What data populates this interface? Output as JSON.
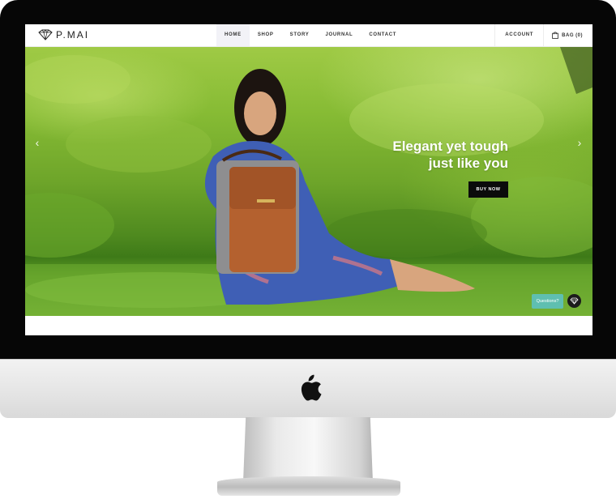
{
  "brand": {
    "name": "P.MAI"
  },
  "nav": {
    "links": [
      {
        "label": "HOME",
        "active": true
      },
      {
        "label": "SHOP",
        "active": false
      },
      {
        "label": "STORY",
        "active": false
      },
      {
        "label": "JOURNAL",
        "active": false
      },
      {
        "label": "CONTACT",
        "active": false
      }
    ],
    "account_label": "ACCOUNT",
    "bag_label": "BAG (0)"
  },
  "hero": {
    "title_line1": "Elegant yet tough",
    "title_line2": "just like you",
    "cta_label": "BUY NOW",
    "prev_icon": "chevron-left-icon",
    "next_icon": "chevron-right-icon"
  },
  "chat": {
    "label": "Questions?"
  },
  "colors": {
    "accent": "#5fbfb0",
    "cta": "#0b0b0b",
    "nav_active_bg": "#f2f2f7"
  }
}
